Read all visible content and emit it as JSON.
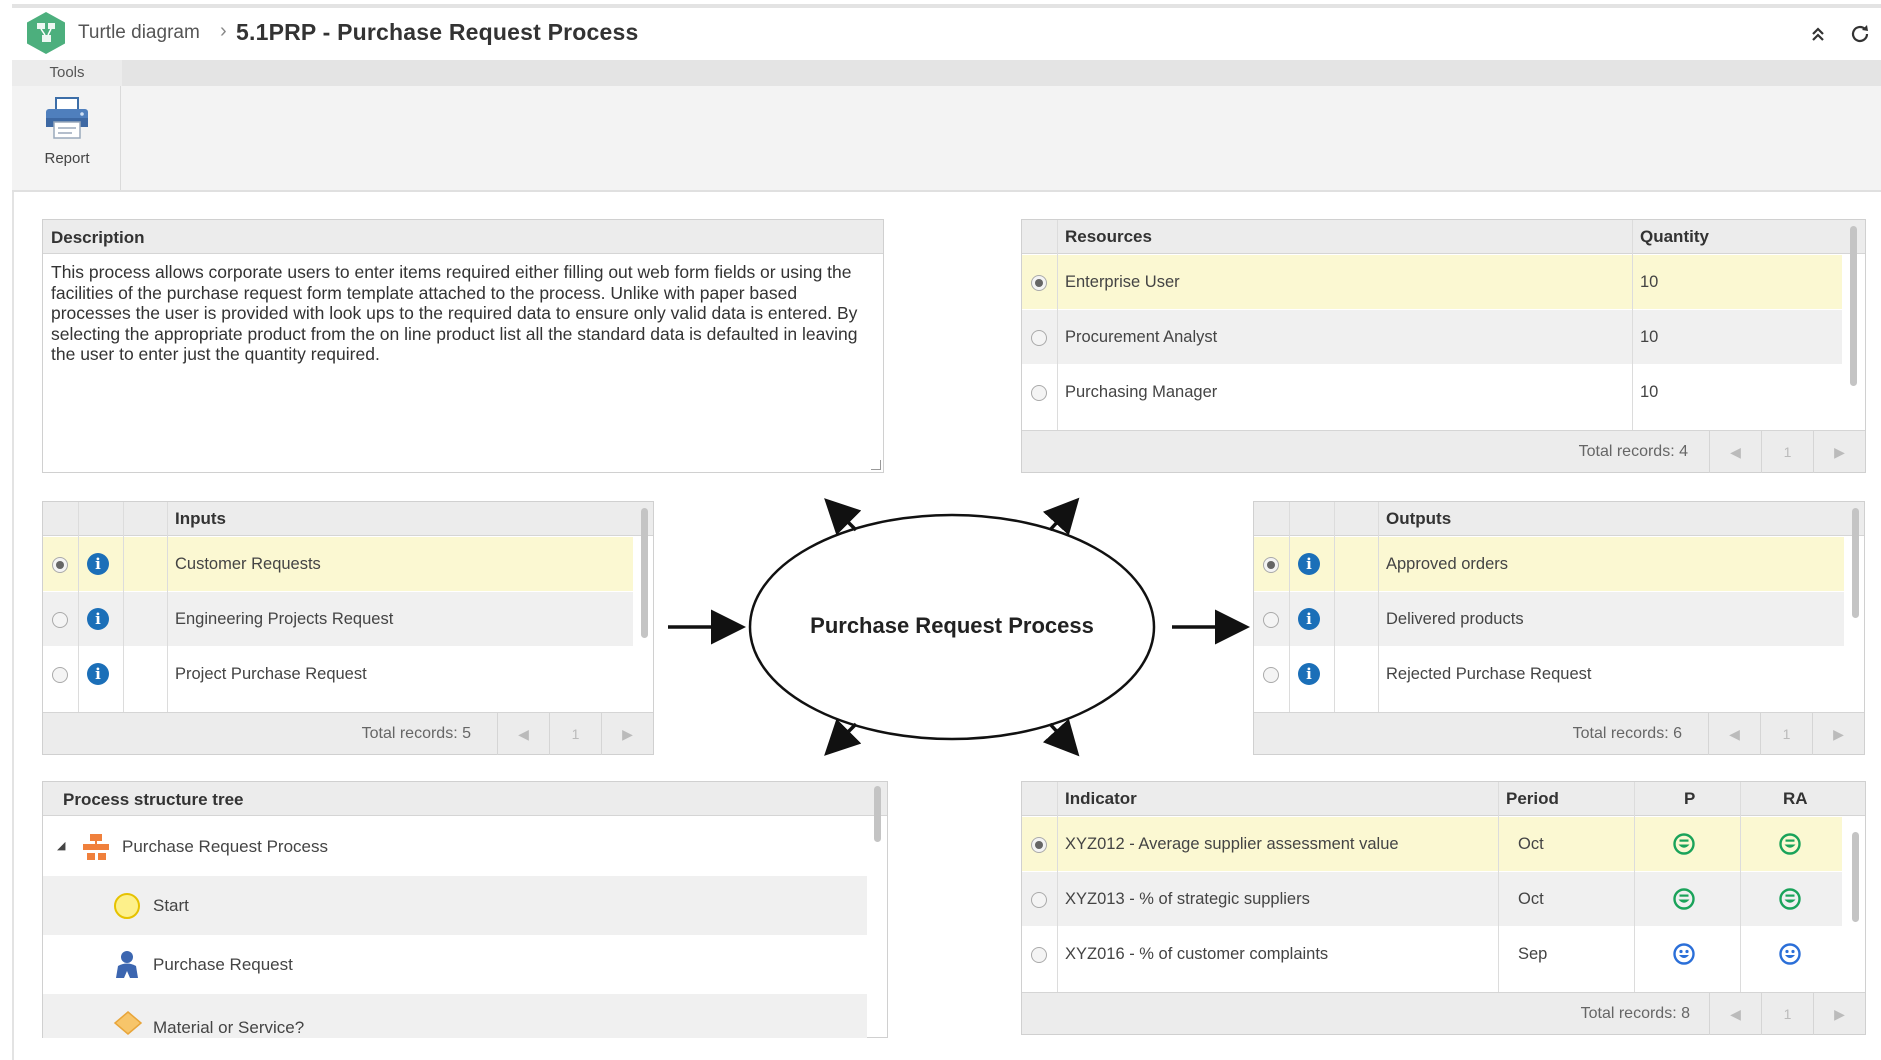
{
  "header": {
    "breadcrumb_root": "Turtle diagram",
    "breadcrumb_sep": "›",
    "title": "5.1PRP - Purchase Request Process",
    "collapse_icon": "double-chevron-up-icon",
    "refresh_icon": "refresh-icon"
  },
  "toolbar": {
    "tab_label": "Tools",
    "report_label": "Report",
    "report_icon": "printer-icon"
  },
  "description": {
    "label": "Description",
    "text": "This process allows corporate users to enter items required either filling out web form fields or using the facilities of the purchase request form template attached to the process. Unlike with paper based processes the user is provided with look ups to the required data to ensure only valid data is entered. By selecting the appropriate product from the on line product list all the standard data is defaulted in leaving the user to enter just the quantity required."
  },
  "resources": {
    "col_resource": "Resources",
    "col_quantity": "Quantity",
    "rows": [
      {
        "name": "Enterprise User",
        "quantity": "10"
      },
      {
        "name": "Procurement Analyst",
        "quantity": "10"
      },
      {
        "name": "Purchasing Manager",
        "quantity": "10"
      }
    ],
    "total": "Total records: 4",
    "page": "1"
  },
  "inputs": {
    "label": "Inputs",
    "rows": [
      {
        "name": "Customer Requests"
      },
      {
        "name": "Engineering Projects Request"
      },
      {
        "name": "Project Purchase Request"
      }
    ],
    "total": "Total records: 5",
    "page": "1"
  },
  "center": {
    "process_name": "Purchase Request Process"
  },
  "outputs": {
    "label": "Outputs",
    "rows": [
      {
        "name": "Approved orders"
      },
      {
        "name": "Delivered products"
      },
      {
        "name": "Rejected Purchase Request"
      }
    ],
    "total": "Total records: 6",
    "page": "1"
  },
  "tree": {
    "label": "Process structure tree",
    "items": [
      {
        "label": "Purchase Request Process",
        "icon": "process-icon"
      },
      {
        "label": "Start",
        "icon": "start-event-icon"
      },
      {
        "label": "Purchase Request",
        "icon": "user-task-icon"
      },
      {
        "label": "Material or Service?",
        "icon": "gateway-icon"
      }
    ]
  },
  "indicators": {
    "col_indicator": "Indicator",
    "col_period": "Period",
    "col_p": "P",
    "col_ra": "RA",
    "rows": [
      {
        "name": "XYZ012 - Average supplier assessment value",
        "period": "Oct",
        "p": "happy-face-icon",
        "ra": "happy-face-icon"
      },
      {
        "name": "XYZ013 - % of strategic suppliers",
        "period": "Oct",
        "p": "happy-face-icon",
        "ra": "happy-face-icon"
      },
      {
        "name": "XYZ016 - % of customer complaints",
        "period": "Sep",
        "p": "smile-face-icon",
        "ra": "smile-face-icon"
      }
    ],
    "total": "Total records: 8",
    "page": "1"
  },
  "colors": {
    "selected_row": "#fbf8d2",
    "info_blue": "#1b6fb8",
    "face_green": "#1aa35a",
    "face_blue": "#2b6fd8",
    "logo_green": "#4caf7d"
  }
}
